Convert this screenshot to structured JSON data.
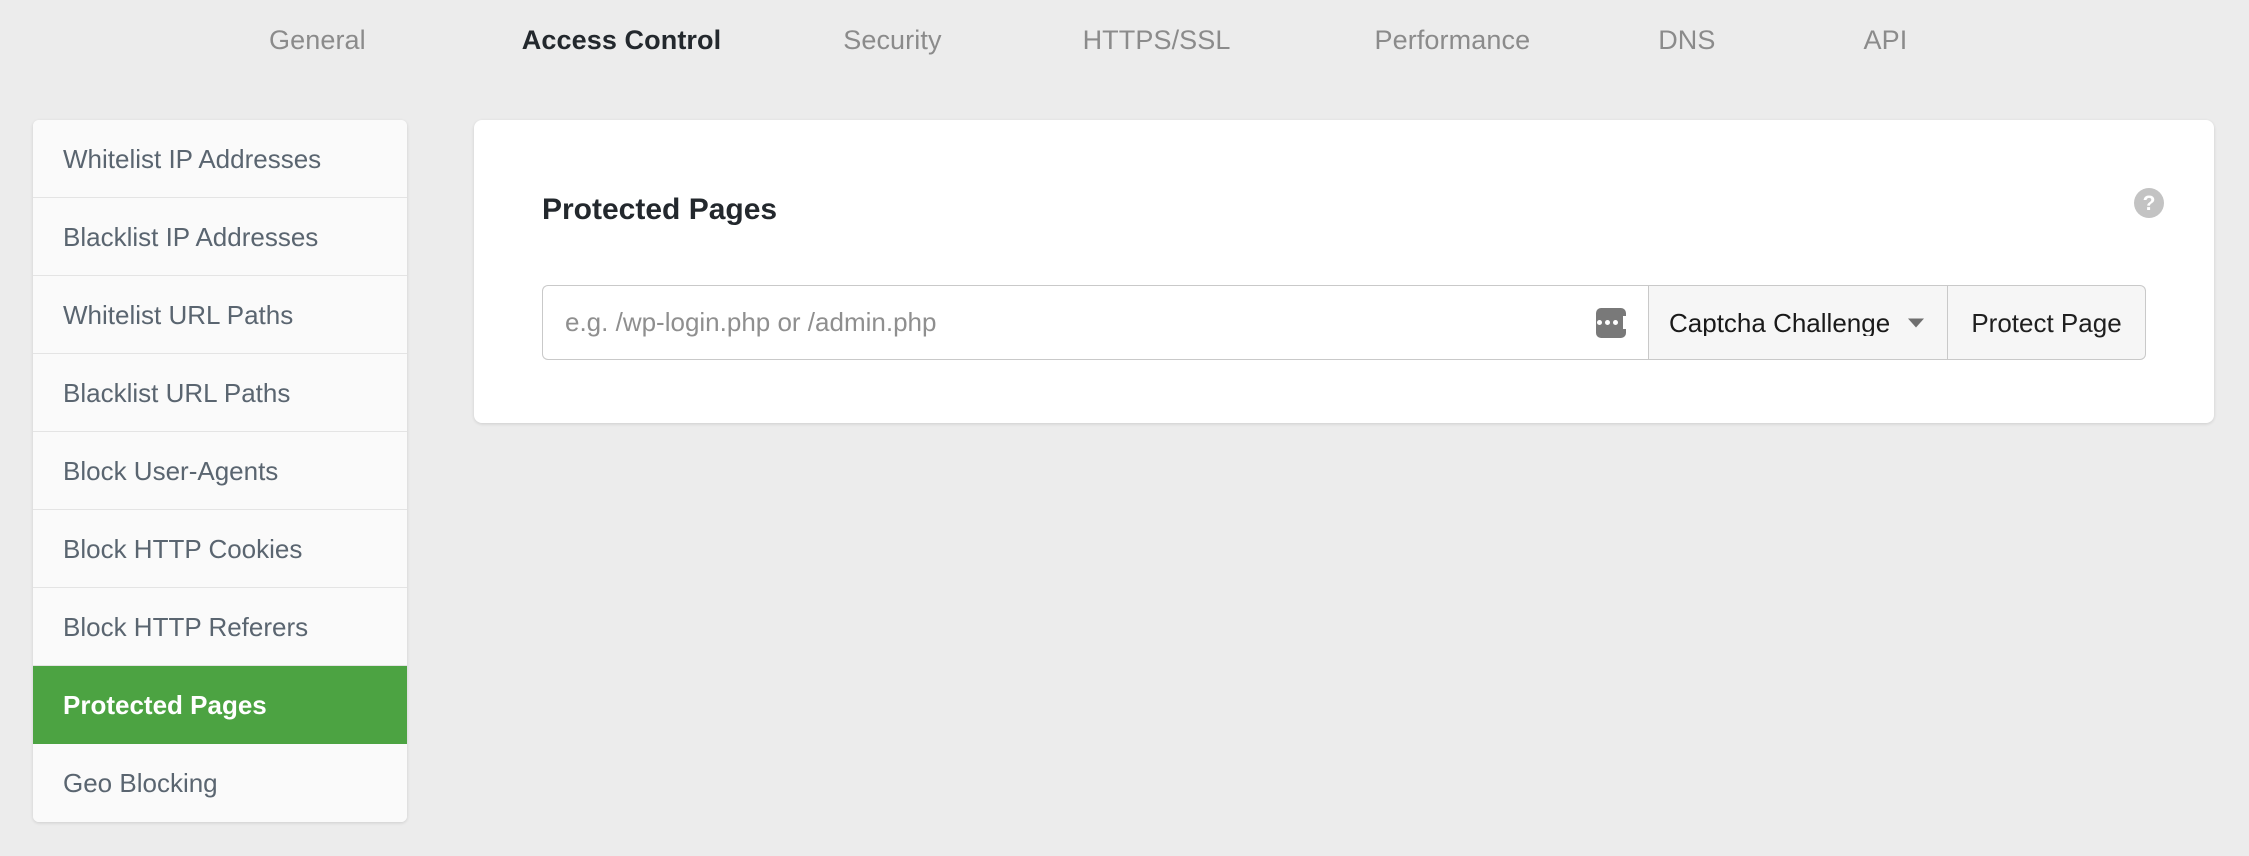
{
  "tabs": [
    {
      "label": "General",
      "active": false
    },
    {
      "label": "Access Control",
      "active": true
    },
    {
      "label": "Security",
      "active": false
    },
    {
      "label": "HTTPS/SSL",
      "active": false
    },
    {
      "label": "Performance",
      "active": false
    },
    {
      "label": "DNS",
      "active": false
    },
    {
      "label": "API",
      "active": false
    }
  ],
  "sidebar": {
    "items": [
      {
        "label": "Whitelist IP Addresses",
        "active": false
      },
      {
        "label": "Blacklist IP Addresses",
        "active": false
      },
      {
        "label": "Whitelist URL Paths",
        "active": false
      },
      {
        "label": "Blacklist URL Paths",
        "active": false
      },
      {
        "label": "Block User-Agents",
        "active": false
      },
      {
        "label": "Block HTTP Cookies",
        "active": false
      },
      {
        "label": "Block HTTP Referers",
        "active": false
      },
      {
        "label": "Protected Pages",
        "active": true
      },
      {
        "label": "Geo Blocking",
        "active": false
      }
    ]
  },
  "card": {
    "title": "Protected Pages",
    "help_icon": "question-mark-circle-icon",
    "help_glyph": "?",
    "form": {
      "path_input": {
        "value": "",
        "placeholder": "e.g. /wp-login.php or /admin.php",
        "autofill_icon": "password-manager-icon"
      },
      "action_select": {
        "selected": "Captcha Challenge",
        "options": [
          "Captcha Challenge"
        ],
        "caret_icon": "chevron-down-icon"
      },
      "submit_label": "Protect Page"
    }
  },
  "colors": {
    "page_background": "#ececec",
    "card_background": "#ffffff",
    "sidebar_background": "#fafafa",
    "active_item": "#4ca342",
    "active_item_text": "#ffffff",
    "tab_inactive_text": "#8b8b8b",
    "tab_active_text": "#23282d",
    "help_icon": "#c3c3c3"
  }
}
